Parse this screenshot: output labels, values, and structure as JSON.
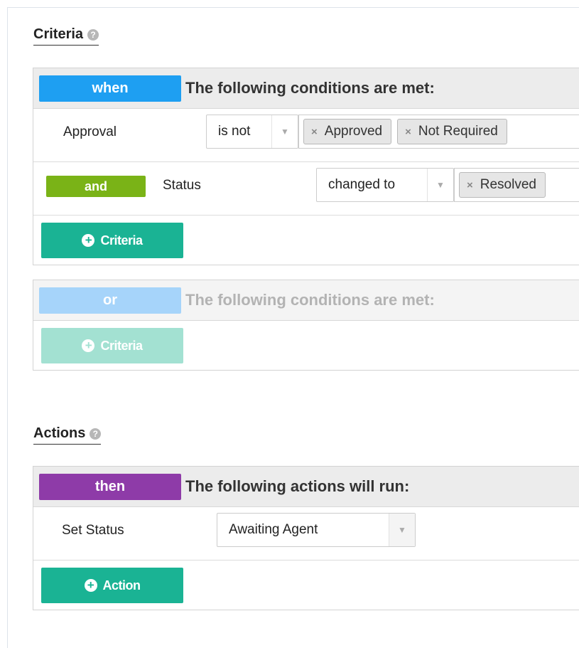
{
  "criteria": {
    "title": "Criteria",
    "help_icon": "question-circle-icon",
    "when_group": {
      "tag": "when",
      "tag_color": "#1e9ff2",
      "heading": "The following conditions are met:",
      "conditions": [
        {
          "field": "Approval",
          "operator": "is not",
          "values": [
            "Approved",
            "Not Required"
          ]
        },
        {
          "connector": "and",
          "connector_color": "#7ab317",
          "field": "Status",
          "operator": "changed to",
          "values": [
            "Resolved"
          ]
        }
      ],
      "add_button": "Criteria"
    },
    "or_group": {
      "tag": "or",
      "tag_color": "#a6d4fa",
      "heading": "The following conditions are met:",
      "add_button": "Criteria"
    }
  },
  "actions": {
    "title": "Actions",
    "help_icon": "question-circle-icon",
    "then_group": {
      "tag": "then",
      "tag_color": "#8e3ba8",
      "heading": "The following actions will run:",
      "actions": [
        {
          "field": "Set Status",
          "value": "Awaiting Agent"
        }
      ],
      "add_button": "Action"
    }
  },
  "colors": {
    "add_button": "#1ab394",
    "add_button_disabled": "#a3e1d2"
  }
}
